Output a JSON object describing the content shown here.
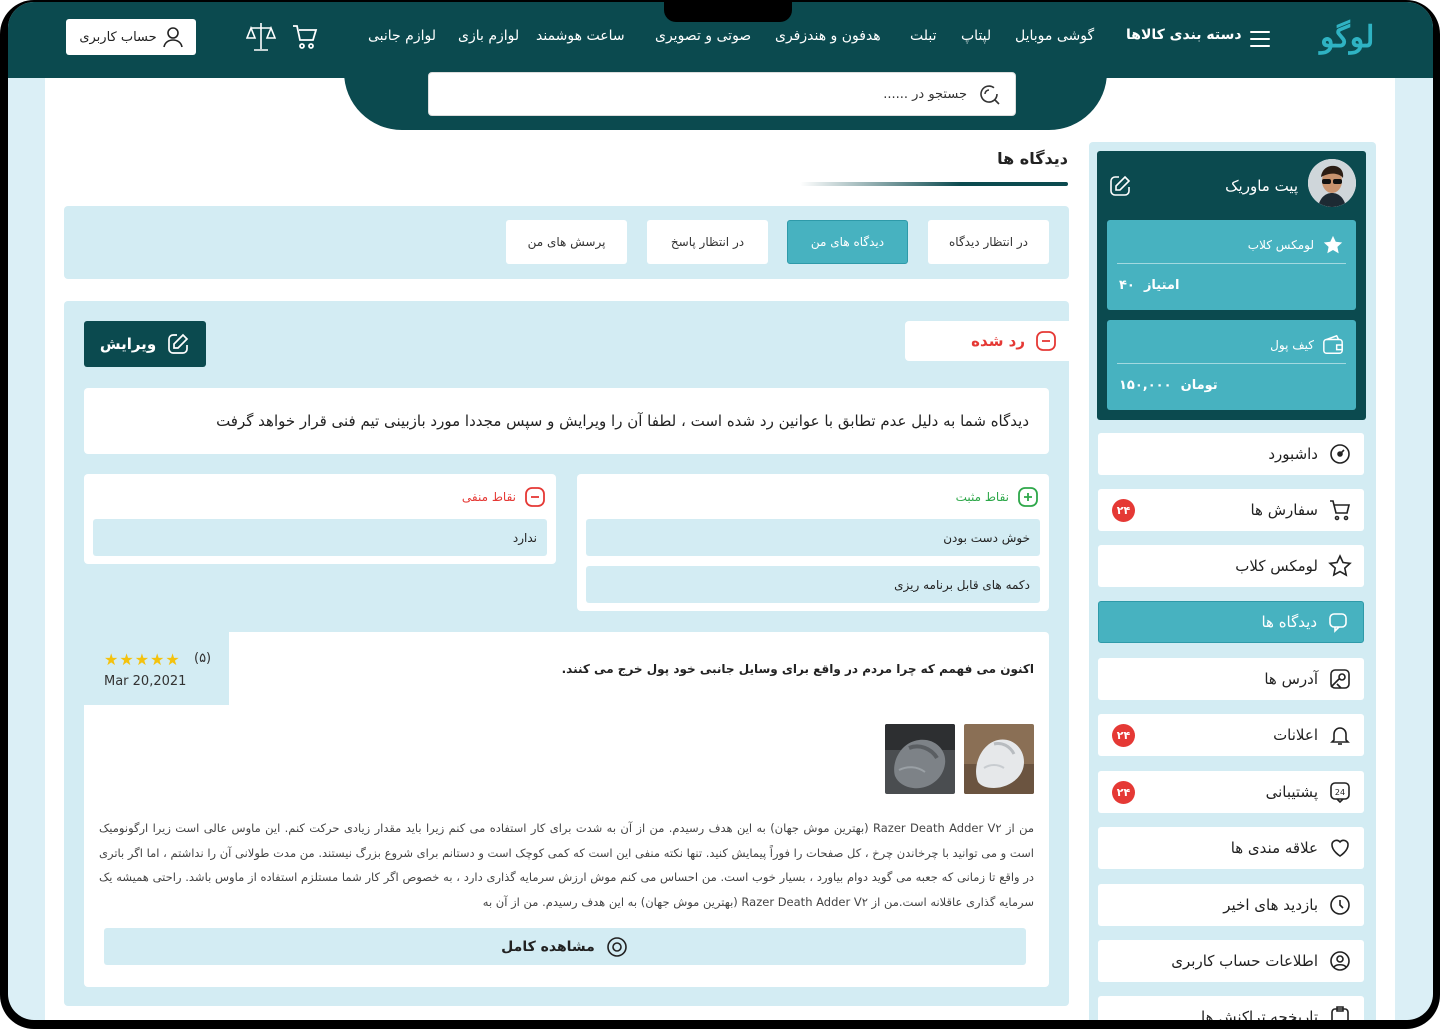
{
  "header": {
    "logo": "لوگو",
    "category_label": "دسته بندی کالاها",
    "menu": [
      "گوشی موبایل",
      "لپتاپ",
      "تبلت",
      "هدفون و هندزفری",
      "صوتی و تصویری",
      "ساعت هوشمند",
      "لوازم بازی",
      "لوازم جانبی"
    ],
    "account_label": "حساب کاربری"
  },
  "search": {
    "placeholder": "جستجو در ......"
  },
  "page": {
    "title": "دیدگاه ها"
  },
  "tabs": [
    {
      "label": "در انتظار دیدگاه",
      "active": false
    },
    {
      "label": "دیدگاه های من",
      "active": true
    },
    {
      "label": "در انتظار پاسخ",
      "active": false
    },
    {
      "label": "پرسش های من",
      "active": false
    }
  ],
  "comment": {
    "status_label": "رد شده",
    "edit_label": "ویرایش",
    "message": "دیدگاه شما به دلیل عدم تطابق با عوانین رد شده است ، لطفا آن را ویرایش و سپس مجددا مورد بازبینی تیم فنی قرار خواهد گرفت",
    "positive_title": "نقاط مثبت",
    "positives": [
      "خوش دست بودن",
      "دکمه های قابل برنامه ریزی"
    ],
    "negative_title": "نقاط منفی",
    "negatives": [
      "ندارد"
    ],
    "stars": "★★★★★",
    "rating": "(۵)",
    "date": "Mar 20,2021",
    "review_title": "اکنون می فهمم که چرا مردم در واقع برای وسایل جانبی خود پول خرج می کنند.",
    "review_text": "من از Razer Death Adder V۲ (بهترین موش جهان) به این هدف رسیدم. من از آن به شدت برای کار استفاده می کنم زیرا باید مقدار زیادی حرکت کنم. این ماوس عالی است زیرا ارگونومیک است و می توانید با چرخاندن چرخ ، کل صفحات را فوراً پیمایش کنید. تنها نکته منفی این است که کمی کوچک است و دستانم برای شروع بزرگ نیستند. من مدت طولانی آن را نداشتم ، اما اگر باتری در واقع تا زمانی که جعبه می گوید دوام بیاورد ، بسیار خوب است. من احساس می کنم موش ارزش سرمایه گذاری دارد ، به خصوص اگر کار شما مستلزم استفاده از ماوس باشد. راحتی همیشه یک سرمایه گذاری عاقلانه است.من از Razer Death Adder V۲ (بهترین موش جهان) به این هدف رسیدم. من از آن به",
    "view_full_label": "مشاهده کامل"
  },
  "profile": {
    "name": "پیت ماوریک",
    "club_label": "لومکس کلاب",
    "points_label": "امتیاز",
    "points_value": "۴۰",
    "wallet_label": "کیف پول",
    "wallet_value": "۱۵۰,۰۰۰",
    "wallet_unit": "تومان"
  },
  "sidebar": [
    {
      "label": "داشبورد",
      "icon": "dashboard-icon",
      "badge": ""
    },
    {
      "label": "سفارش ها",
      "icon": "cart-icon",
      "badge": "۲۴"
    },
    {
      "label": "لومکس کلاب",
      "icon": "star-icon",
      "badge": ""
    },
    {
      "label": "دیدگاه ها",
      "icon": "comment-icon",
      "badge": "",
      "active": true
    },
    {
      "label": "آدرس ها",
      "icon": "map-icon",
      "badge": ""
    },
    {
      "label": "اعلانات",
      "icon": "bell-icon",
      "badge": "۲۴"
    },
    {
      "label": "پشتیبانی",
      "icon": "support-24-icon",
      "badge": "۲۴"
    },
    {
      "label": "علاقه مندی ها",
      "icon": "heart-icon",
      "badge": ""
    },
    {
      "label": "بازدید های اخیر",
      "icon": "clock-icon",
      "badge": ""
    },
    {
      "label": "اطلاعات حساب کاربری",
      "icon": "user-circle-icon",
      "badge": ""
    },
    {
      "label": "تاریخچه تراکنش ها",
      "icon": "clipboard-icon",
      "badge": ""
    }
  ],
  "colors": {
    "primary": "#0b4a4f",
    "accent": "#47b2c0",
    "panel": "#d3ecf3",
    "danger": "#e53935",
    "success": "#2ea84a",
    "star": "#f4c20d"
  }
}
